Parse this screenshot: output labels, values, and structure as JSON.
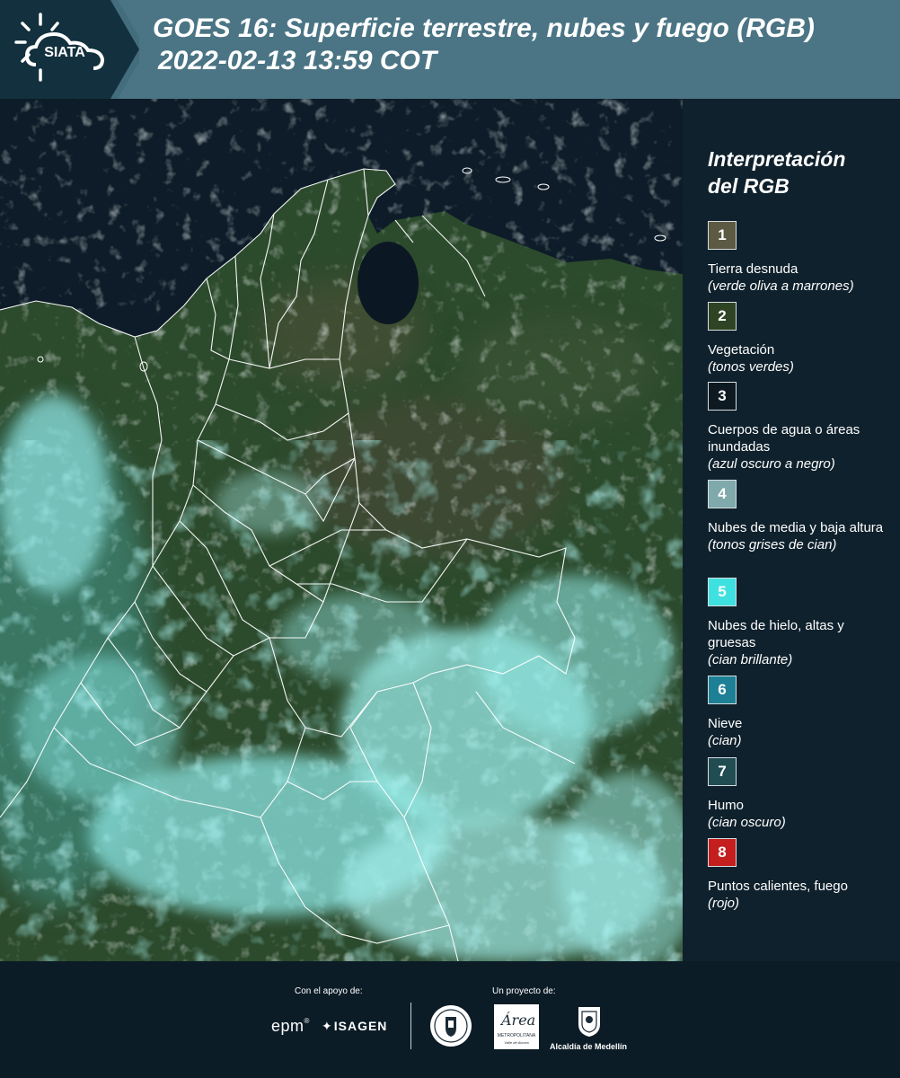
{
  "header": {
    "logo_text": "SIATA",
    "title_line1": "GOES 16: Superficie terrestre, nubes y fuego (RGB)",
    "title_line2": "2022-02-13 13:59 COT"
  },
  "colors": {
    "header_bg": "#4b7585",
    "panel_bg": "#0f212c",
    "page_bg": "#0c1c27",
    "border_lines": "#ffffff"
  },
  "legend": {
    "title_line1": "Interpretación",
    "title_line2": "del RGB",
    "items": [
      {
        "num": "1",
        "color": "#5d5a43",
        "label": "Tierra desnuda",
        "desc": "(verde oliva a marrones)"
      },
      {
        "num": "2",
        "color": "#2e4424",
        "label": "Vegetación",
        "desc": "(tonos verdes)"
      },
      {
        "num": "3",
        "color": "#0e1a22",
        "label": "Cuerpos de agua o áreas inundadas",
        "desc": "(azul oscuro a negro)"
      },
      {
        "num": "4",
        "color": "#7fa9ab",
        "label": "Nubes de media y baja altura",
        "desc": "(tonos grises de cian)"
      },
      {
        "num": "5",
        "color": "#3fe0e0",
        "label": "Nubes de hielo, altas y gruesas",
        "desc": "(cian brillante)"
      },
      {
        "num": "6",
        "color": "#1d8095",
        "label": "Nieve",
        "desc": "(cian)"
      },
      {
        "num": "7",
        "color": "#204c52",
        "label": "Humo",
        "desc": "(cian oscuro)"
      },
      {
        "num": "8",
        "color": "#c41e1e",
        "label": "Puntos calientes, fuego",
        "desc": "(rojo)"
      }
    ]
  },
  "footer": {
    "support_label": "Con el apoyo de:",
    "project_label": "Un proyecto de:",
    "epm": "epm",
    "isagen": "ISAGEN",
    "area_top": "Área",
    "area_bottom": "METROPOLITANA",
    "area_sub": "Valle de Aburrá",
    "alcaldia": "Alcaldía de Medellín"
  }
}
